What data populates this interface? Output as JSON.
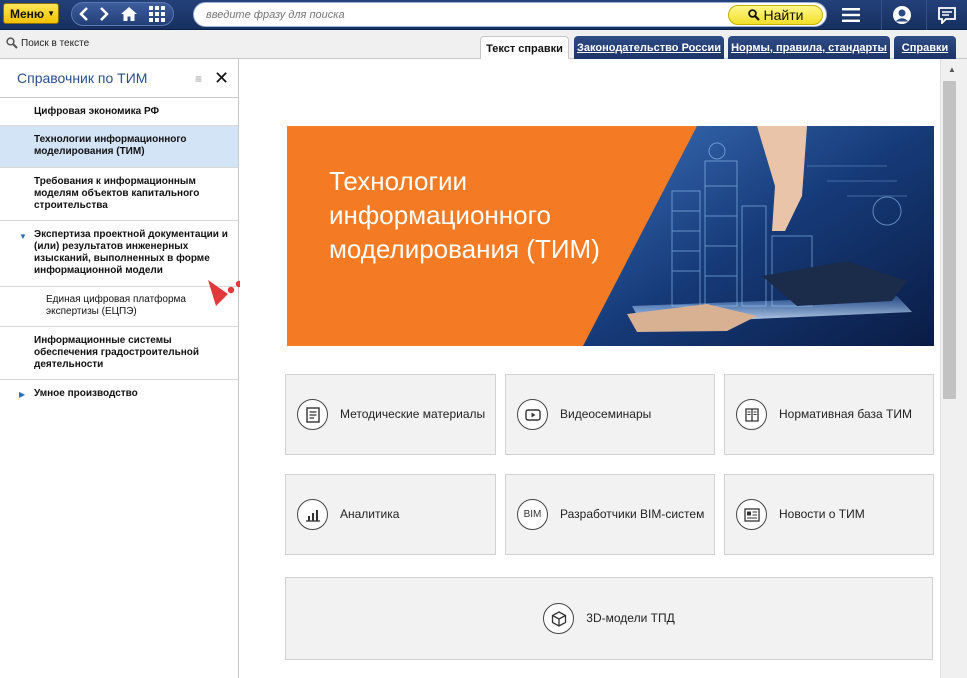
{
  "topbar": {
    "menu_label": "Меню",
    "search_placeholder": "введите фразу для поиска",
    "find_label": "Найти"
  },
  "subbar": {
    "search_in_text": "Поиск в тексте",
    "tabs": [
      {
        "label": "Текст справки",
        "active": true
      },
      {
        "label": "Законодательство России",
        "active": false
      },
      {
        "label": "Нормы, правила, стандарты",
        "active": false
      },
      {
        "label": "Справки",
        "active": false
      }
    ]
  },
  "sidebar": {
    "title": "Справочник по ТИМ",
    "items": [
      {
        "label": "Цифровая экономика РФ"
      },
      {
        "label": "Технологии информационного моделирования (ТИМ)",
        "selected": true
      },
      {
        "label": "Требования к информационным моделям объектов капитального строительства"
      },
      {
        "label": "Экспертиза проектной документации и (или) результатов инженерных изысканий, выполненных в форме информационной модели",
        "expanded": true
      },
      {
        "label": "Единая цифровая платформа экспертизы (ЕЦПЭ)"
      },
      {
        "label": "Информационные системы обеспечения градостроительной деятельности"
      },
      {
        "label": "Умное производство"
      }
    ]
  },
  "main": {
    "banner_title": "Технологии информационного моделирования (ТИМ)",
    "tiles": [
      {
        "label": "Методические материалы",
        "icon": "document-icon"
      },
      {
        "label": "Видеосеминары",
        "icon": "play-icon"
      },
      {
        "label": "Нормативная база ТИМ",
        "icon": "law-book-icon"
      },
      {
        "label": "Аналитика",
        "icon": "chart-icon"
      },
      {
        "label": "Разработчики BIM-систем",
        "icon": "bim-icon",
        "icon_text": "BIM"
      },
      {
        "label": "Новости о ТИМ",
        "icon": "news-icon"
      },
      {
        "label": "3D-модели ТПД",
        "icon": "cube-icon"
      }
    ]
  },
  "colors": {
    "topbar": "#1c3567",
    "accent_yellow": "#f2e02a",
    "banner_orange": "#f47b24",
    "sidebar_selected": "#d4e4f7",
    "tile_bg": "#f2f2f2"
  }
}
